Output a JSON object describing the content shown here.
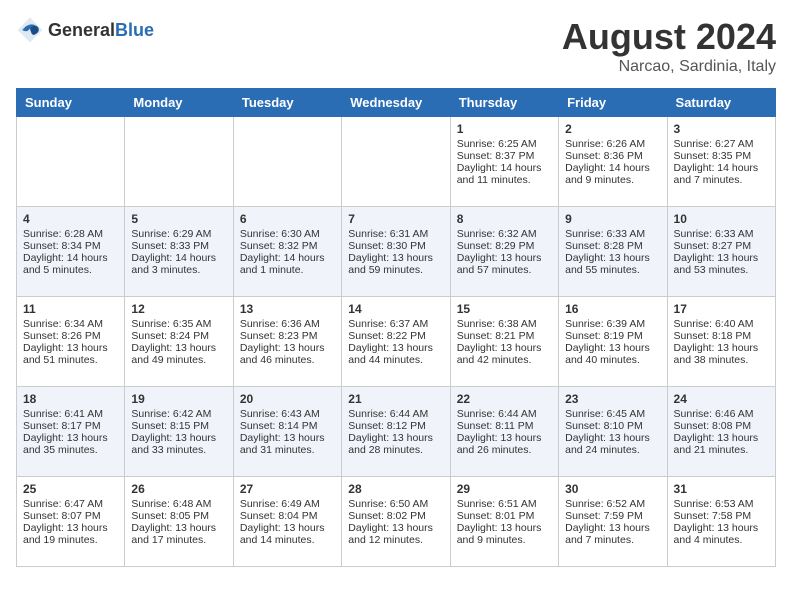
{
  "header": {
    "logo_general": "General",
    "logo_blue": "Blue",
    "month_year": "August 2024",
    "location": "Narcao, Sardinia, Italy"
  },
  "days_of_week": [
    "Sunday",
    "Monday",
    "Tuesday",
    "Wednesday",
    "Thursday",
    "Friday",
    "Saturday"
  ],
  "weeks": [
    [
      {
        "day": "",
        "content": ""
      },
      {
        "day": "",
        "content": ""
      },
      {
        "day": "",
        "content": ""
      },
      {
        "day": "",
        "content": ""
      },
      {
        "day": "1",
        "sunrise": "Sunrise: 6:25 AM",
        "sunset": "Sunset: 8:37 PM",
        "daylight": "Daylight: 14 hours and 11 minutes."
      },
      {
        "day": "2",
        "sunrise": "Sunrise: 6:26 AM",
        "sunset": "Sunset: 8:36 PM",
        "daylight": "Daylight: 14 hours and 9 minutes."
      },
      {
        "day": "3",
        "sunrise": "Sunrise: 6:27 AM",
        "sunset": "Sunset: 8:35 PM",
        "daylight": "Daylight: 14 hours and 7 minutes."
      }
    ],
    [
      {
        "day": "4",
        "sunrise": "Sunrise: 6:28 AM",
        "sunset": "Sunset: 8:34 PM",
        "daylight": "Daylight: 14 hours and 5 minutes."
      },
      {
        "day": "5",
        "sunrise": "Sunrise: 6:29 AM",
        "sunset": "Sunset: 8:33 PM",
        "daylight": "Daylight: 14 hours and 3 minutes."
      },
      {
        "day": "6",
        "sunrise": "Sunrise: 6:30 AM",
        "sunset": "Sunset: 8:32 PM",
        "daylight": "Daylight: 14 hours and 1 minute."
      },
      {
        "day": "7",
        "sunrise": "Sunrise: 6:31 AM",
        "sunset": "Sunset: 8:30 PM",
        "daylight": "Daylight: 13 hours and 59 minutes."
      },
      {
        "day": "8",
        "sunrise": "Sunrise: 6:32 AM",
        "sunset": "Sunset: 8:29 PM",
        "daylight": "Daylight: 13 hours and 57 minutes."
      },
      {
        "day": "9",
        "sunrise": "Sunrise: 6:33 AM",
        "sunset": "Sunset: 8:28 PM",
        "daylight": "Daylight: 13 hours and 55 minutes."
      },
      {
        "day": "10",
        "sunrise": "Sunrise: 6:33 AM",
        "sunset": "Sunset: 8:27 PM",
        "daylight": "Daylight: 13 hours and 53 minutes."
      }
    ],
    [
      {
        "day": "11",
        "sunrise": "Sunrise: 6:34 AM",
        "sunset": "Sunset: 8:26 PM",
        "daylight": "Daylight: 13 hours and 51 minutes."
      },
      {
        "day": "12",
        "sunrise": "Sunrise: 6:35 AM",
        "sunset": "Sunset: 8:24 PM",
        "daylight": "Daylight: 13 hours and 49 minutes."
      },
      {
        "day": "13",
        "sunrise": "Sunrise: 6:36 AM",
        "sunset": "Sunset: 8:23 PM",
        "daylight": "Daylight: 13 hours and 46 minutes."
      },
      {
        "day": "14",
        "sunrise": "Sunrise: 6:37 AM",
        "sunset": "Sunset: 8:22 PM",
        "daylight": "Daylight: 13 hours and 44 minutes."
      },
      {
        "day": "15",
        "sunrise": "Sunrise: 6:38 AM",
        "sunset": "Sunset: 8:21 PM",
        "daylight": "Daylight: 13 hours and 42 minutes."
      },
      {
        "day": "16",
        "sunrise": "Sunrise: 6:39 AM",
        "sunset": "Sunset: 8:19 PM",
        "daylight": "Daylight: 13 hours and 40 minutes."
      },
      {
        "day": "17",
        "sunrise": "Sunrise: 6:40 AM",
        "sunset": "Sunset: 8:18 PM",
        "daylight": "Daylight: 13 hours and 38 minutes."
      }
    ],
    [
      {
        "day": "18",
        "sunrise": "Sunrise: 6:41 AM",
        "sunset": "Sunset: 8:17 PM",
        "daylight": "Daylight: 13 hours and 35 minutes."
      },
      {
        "day": "19",
        "sunrise": "Sunrise: 6:42 AM",
        "sunset": "Sunset: 8:15 PM",
        "daylight": "Daylight: 13 hours and 33 minutes."
      },
      {
        "day": "20",
        "sunrise": "Sunrise: 6:43 AM",
        "sunset": "Sunset: 8:14 PM",
        "daylight": "Daylight: 13 hours and 31 minutes."
      },
      {
        "day": "21",
        "sunrise": "Sunrise: 6:44 AM",
        "sunset": "Sunset: 8:12 PM",
        "daylight": "Daylight: 13 hours and 28 minutes."
      },
      {
        "day": "22",
        "sunrise": "Sunrise: 6:44 AM",
        "sunset": "Sunset: 8:11 PM",
        "daylight": "Daylight: 13 hours and 26 minutes."
      },
      {
        "day": "23",
        "sunrise": "Sunrise: 6:45 AM",
        "sunset": "Sunset: 8:10 PM",
        "daylight": "Daylight: 13 hours and 24 minutes."
      },
      {
        "day": "24",
        "sunrise": "Sunrise: 6:46 AM",
        "sunset": "Sunset: 8:08 PM",
        "daylight": "Daylight: 13 hours and 21 minutes."
      }
    ],
    [
      {
        "day": "25",
        "sunrise": "Sunrise: 6:47 AM",
        "sunset": "Sunset: 8:07 PM",
        "daylight": "Daylight: 13 hours and 19 minutes."
      },
      {
        "day": "26",
        "sunrise": "Sunrise: 6:48 AM",
        "sunset": "Sunset: 8:05 PM",
        "daylight": "Daylight: 13 hours and 17 minutes."
      },
      {
        "day": "27",
        "sunrise": "Sunrise: 6:49 AM",
        "sunset": "Sunset: 8:04 PM",
        "daylight": "Daylight: 13 hours and 14 minutes."
      },
      {
        "day": "28",
        "sunrise": "Sunrise: 6:50 AM",
        "sunset": "Sunset: 8:02 PM",
        "daylight": "Daylight: 13 hours and 12 minutes."
      },
      {
        "day": "29",
        "sunrise": "Sunrise: 6:51 AM",
        "sunset": "Sunset: 8:01 PM",
        "daylight": "Daylight: 13 hours and 9 minutes."
      },
      {
        "day": "30",
        "sunrise": "Sunrise: 6:52 AM",
        "sunset": "Sunset: 7:59 PM",
        "daylight": "Daylight: 13 hours and 7 minutes."
      },
      {
        "day": "31",
        "sunrise": "Sunrise: 6:53 AM",
        "sunset": "Sunset: 7:58 PM",
        "daylight": "Daylight: 13 hours and 4 minutes."
      }
    ]
  ]
}
